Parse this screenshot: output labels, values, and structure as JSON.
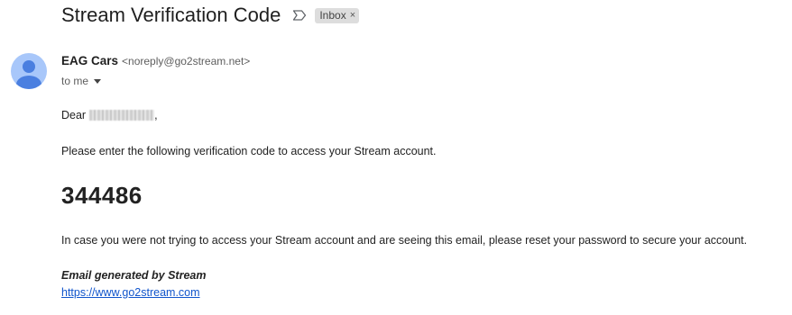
{
  "email": {
    "subject": "Stream Verification Code",
    "label": "Inbox",
    "label_remove": "×",
    "important_icon": "label-important-outline-icon",
    "sender": {
      "name": "EAG Cars",
      "email": "<noreply@go2stream.net>",
      "avatar_icon": "default-person-avatar-icon"
    },
    "recipient_text": "to me",
    "body": {
      "greeting_prefix": "Dear",
      "greeting_suffix": ",",
      "instruction": "Please enter the following verification code to access your Stream account.",
      "code": "344486",
      "warning": "In case you were not trying to access your Stream account and are seeing this email, please reset your password to secure your account.",
      "generated_by": "Email generated by Stream",
      "link": "https://www.go2stream.com"
    }
  },
  "colors": {
    "avatar_bg": "#a8c7fa",
    "avatar_fg": "#4a7fe0",
    "link": "#1155cc",
    "chip_bg": "#dddddd"
  }
}
